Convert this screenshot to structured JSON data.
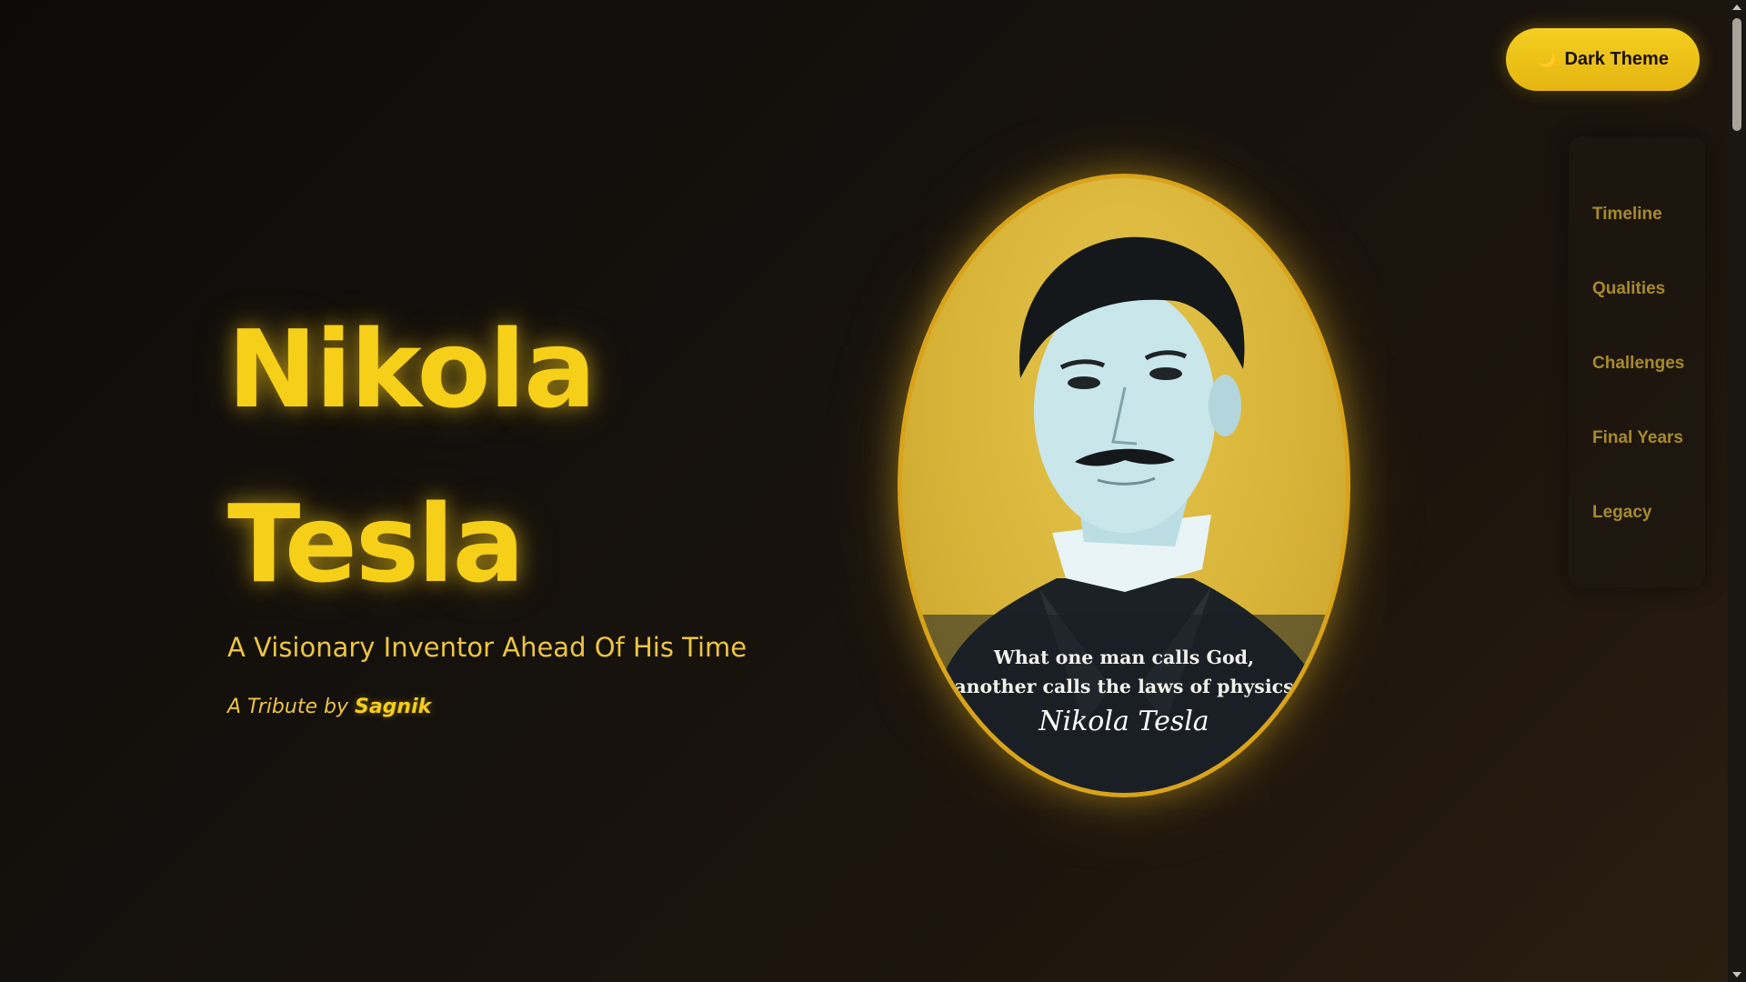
{
  "theme_toggle": {
    "icon": "moon-icon",
    "label": "Dark Theme"
  },
  "nav": {
    "items": [
      {
        "label": "Timeline"
      },
      {
        "label": "Qualities"
      },
      {
        "label": "Challenges"
      },
      {
        "label": "Final Years"
      },
      {
        "label": "Legacy"
      }
    ]
  },
  "hero": {
    "title_line1": "Nikola",
    "title_line2": "Tesla",
    "subtitle": "A Visionary Inventor Ahead Of His Time",
    "tribute_prefix": "A Tribute by",
    "tribute_author": "Sagnik"
  },
  "portrait": {
    "quote_line1": "What one man calls God,",
    "quote_line2": "another calls the laws of physics",
    "signature": "Nikola Tesla"
  },
  "colors": {
    "accent": "#f6cf19",
    "background": "#15110d",
    "nav_text": "#a78a2c",
    "frame": "#d9a31a"
  }
}
